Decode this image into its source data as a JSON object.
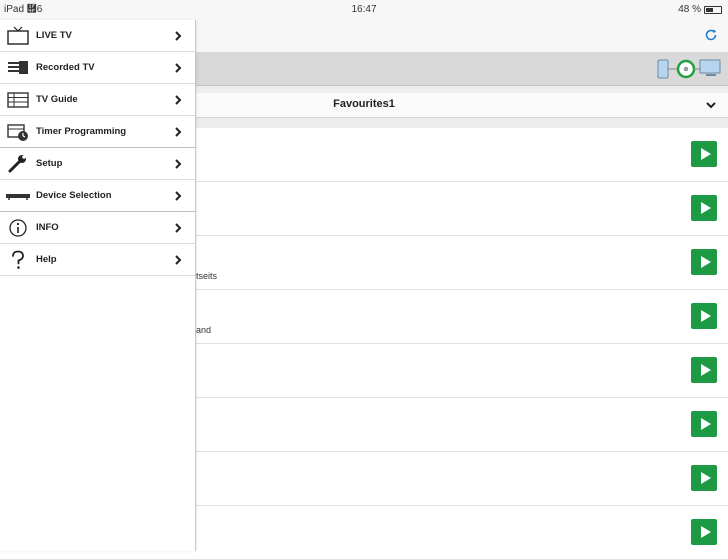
{
  "status_bar": {
    "carrier": "iPad ὏6",
    "time": "16:47",
    "battery": "48 %",
    "battery_level": 0.48
  },
  "toolbar": {
    "refresh_icon": "refresh-icon"
  },
  "device_bar": {
    "connection_icon": "device-connection-icon",
    "status_color": "#22a13f"
  },
  "favourites": {
    "selected": "Favourites1"
  },
  "menu": {
    "items": [
      {
        "label": "LIVE TV",
        "icon": "tv-icon"
      },
      {
        "label": "Recorded TV",
        "icon": "recorded-tv-icon"
      },
      {
        "label": "TV Guide",
        "icon": "tv-guide-icon"
      },
      {
        "label": "Timer Programming",
        "icon": "timer-icon"
      },
      {
        "label": "Setup",
        "icon": "wrench-icon"
      },
      {
        "label": "Device Selection",
        "icon": "device-icon"
      },
      {
        "label": "INFO",
        "icon": "info-icon"
      },
      {
        "label": "Help",
        "icon": "help-icon"
      }
    ]
  },
  "channels": [
    {
      "sub": ""
    },
    {
      "sub": ""
    },
    {
      "sub": "tseits"
    },
    {
      "sub": "and"
    },
    {
      "sub": ""
    },
    {
      "sub": ""
    },
    {
      "sub": ""
    },
    {
      "sub": ""
    }
  ],
  "colors": {
    "accent_green": "#1e9a44",
    "refresh_blue": "#1a7ad6"
  }
}
